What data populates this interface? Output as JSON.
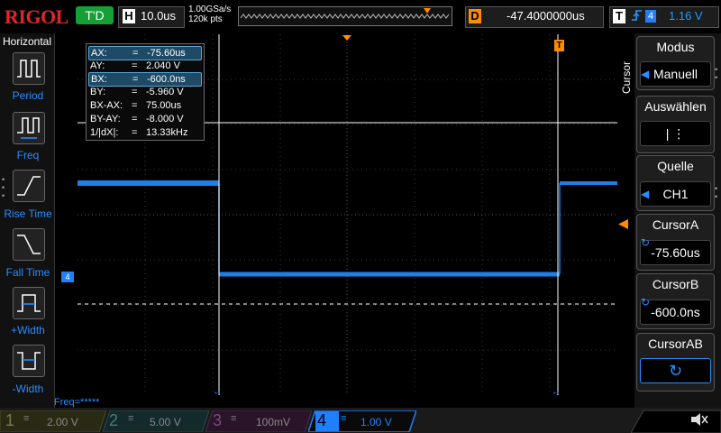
{
  "brand": {
    "logo": "RIGOL"
  },
  "topbar": {
    "trigger_status": "T'D",
    "timebase_label": "H",
    "timebase_value": "10.0us",
    "sample_rate": "1.00GSa/s",
    "memory_depth": "120k pts",
    "trigger_offset_label": "D",
    "trigger_offset_value": "-47.4000000us",
    "trigger_label": "T",
    "trigger_edge_icon": "rising-edge-icon",
    "trigger_source": "4",
    "trigger_level": "1.16 V"
  },
  "left_panel": {
    "title": "Horizontal",
    "items": [
      {
        "label": "Period",
        "icon": "period-icon"
      },
      {
        "label": "Freq",
        "icon": "frequency-icon"
      },
      {
        "label": "Rise Time",
        "icon": "rise-time-icon"
      },
      {
        "label": "Fall Time",
        "icon": "fall-time-icon"
      },
      {
        "label": "+Width",
        "icon": "positive-width-icon"
      },
      {
        "label": "-Width",
        "icon": "negative-width-icon"
      }
    ]
  },
  "measurements": [
    {
      "key": "AX:",
      "eq": "=",
      "value": "-75.60us",
      "highlight": true
    },
    {
      "key": "AY:",
      "eq": "=",
      "value": "2.040 V",
      "highlight": false
    },
    {
      "key": "BX:",
      "eq": "=",
      "value": "-600.0ns",
      "highlight": true
    },
    {
      "key": "BY:",
      "eq": "=",
      "value": "-5.960 V",
      "highlight": false
    },
    {
      "key": "BX-AX:",
      "eq": "=",
      "value": "75.00us",
      "highlight": false
    },
    {
      "key": "BY-AY:",
      "eq": "=",
      "value": "-8.000 V",
      "highlight": false
    },
    {
      "key": "1/|dX|:",
      "eq": "=",
      "value": "13.33kHz",
      "highlight": false
    }
  ],
  "screen": {
    "ch4_marker": "4",
    "freq_readout": "Freq=*****",
    "trigger_position_marker": "T"
  },
  "right_menu": {
    "vertical_title": "Cursor",
    "items": [
      {
        "head": "Modus",
        "value": "Manuell"
      },
      {
        "head": "Auswählen",
        "value": "| ⋮"
      },
      {
        "head": "Quelle",
        "value": "CH1"
      },
      {
        "head": "CursorA",
        "value": "-75.60us"
      },
      {
        "head": "CursorB",
        "value": "-600.0ns"
      },
      {
        "head": "CursorAB",
        "value": "↻"
      }
    ]
  },
  "channels": [
    {
      "num": "1",
      "value": "2.00 V",
      "color": "#3b3b00",
      "active": false
    },
    {
      "num": "2",
      "value": "5.00 V",
      "color": "#003b3b",
      "active": false
    },
    {
      "num": "3",
      "value": "100mV",
      "color": "#3b003b",
      "active": false
    },
    {
      "num": "4",
      "value": "1.00 V",
      "color": "#1f7fff",
      "active": true
    }
  ],
  "colors": {
    "ch4_trace": "#1e7fe8",
    "accent_blue": "#2a8cff",
    "trigger_orange": "#ff8c00",
    "trig_status_green": "#14a036",
    "logo_red": "#e0262b"
  }
}
